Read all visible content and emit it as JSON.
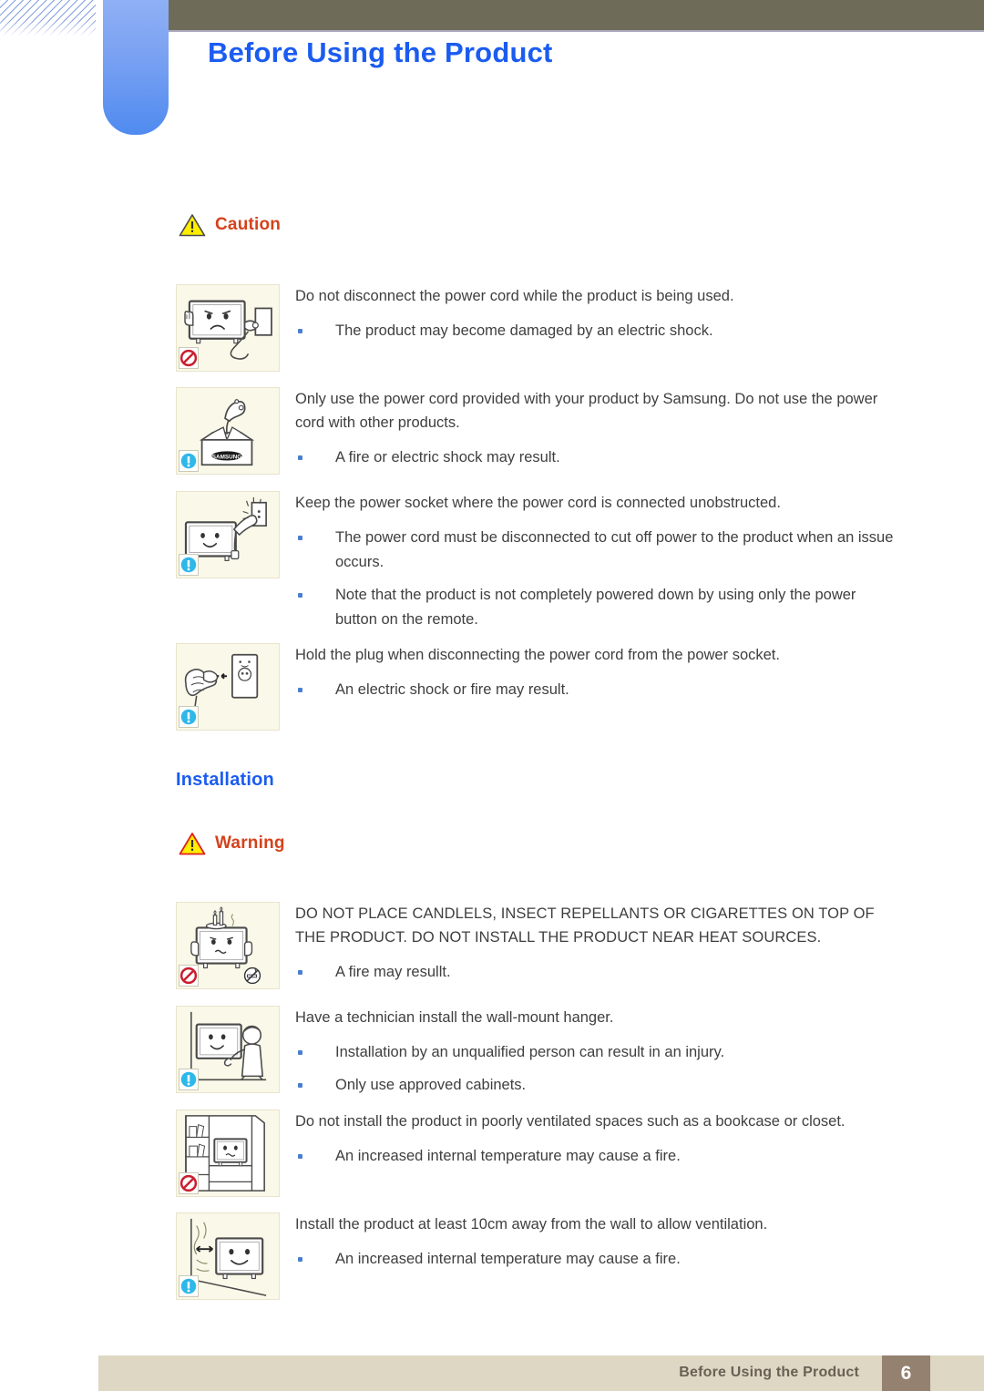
{
  "header": {
    "title": "Before Using the Product",
    "title_color": "#1b5cf0",
    "bar_color": "#6e6c58",
    "tab_color": "#5f93f1"
  },
  "sections": [
    {
      "kind": "alert",
      "label": "Caution",
      "icon": "warning-triangle-icon",
      "label_color": "#d4421c"
    },
    {
      "kind": "heading",
      "label": "Installation",
      "label_color": "#1b5cf0"
    },
    {
      "kind": "alert",
      "label": "Warning",
      "icon": "warning-triangle-icon",
      "label_color": "#d4421c"
    }
  ],
  "caution_heading": "Caution",
  "installation_heading": "Installation",
  "warning_heading": "Warning",
  "items": [
    {
      "illustration": "monitor-unplug-refusal-illustration",
      "badge": "prohibition-icon",
      "badge2": null,
      "lead": "Do not disconnect the power cord while the product is being used.",
      "caps": false,
      "bullets": [
        "The product may become damaged by an electric shock."
      ]
    },
    {
      "illustration": "samsung-box-power-cord-illustration",
      "badge": "info-exclamation-icon",
      "badge2": null,
      "lead": "Only use the power cord provided with your product by Samsung. Do not use the power cord with other products.",
      "caps": false,
      "bullets": [
        "A fire or electric shock may result."
      ]
    },
    {
      "illustration": "monitor-plug-into-socket-illustration",
      "badge": "info-exclamation-icon",
      "badge2": null,
      "lead": "Keep the power socket where the power cord is connected unobstructed.",
      "caps": false,
      "bullets": [
        "The power cord must be disconnected to cut off power to the product when an issue occurs.",
        "Note that the product is not completely powered down by using only the power button on the remote."
      ]
    },
    {
      "illustration": "hand-holding-plug-illustration",
      "badge": "info-exclamation-icon",
      "badge2": null,
      "lead": "Hold the plug when disconnecting the power cord from the power socket.",
      "caps": false,
      "bullets": [
        "An electric shock or fire may result."
      ]
    },
    {
      "illustration": "candles-on-monitor-illustration",
      "badge": "prohibition-icon",
      "badge2": "no-smoking-icon",
      "lead": "DO NOT PLACE CANDLELS, INSECT REPELLANTS OR CIGARETTES ON TOP OF THE PRODUCT. DO NOT INSTALL THE PRODUCT NEAR HEAT SOURCES.",
      "caps": true,
      "bullets": [
        "A fire may resullt."
      ]
    },
    {
      "illustration": "technician-wall-mount-illustration",
      "badge": "info-exclamation-icon",
      "badge2": null,
      "lead": "Have a technician install the wall-mount hanger.",
      "caps": false,
      "bullets": [
        "Installation by an unqualified person can result in an injury.",
        "Only use approved cabinets."
      ]
    },
    {
      "illustration": "monitor-in-bookcase-illustration",
      "badge": "prohibition-icon",
      "badge2": null,
      "lead": "Do not install the product in poorly ventilated spaces such as a bookcase or closet.",
      "caps": false,
      "bullets": [
        "An increased internal temperature may cause a fire."
      ]
    },
    {
      "illustration": "monitor-wall-clearance-illustration",
      "badge": "info-exclamation-icon",
      "badge2": null,
      "lead": "Install the product at least 10cm away from the wall to allow ventilation.",
      "caps": false,
      "bullets": [
        "An increased internal temperature may cause a fire."
      ]
    }
  ],
  "footer": {
    "label": "Before Using the Product",
    "page_number": "6",
    "bar_color": "#ddd7c3",
    "page_box_color": "#94816f"
  }
}
